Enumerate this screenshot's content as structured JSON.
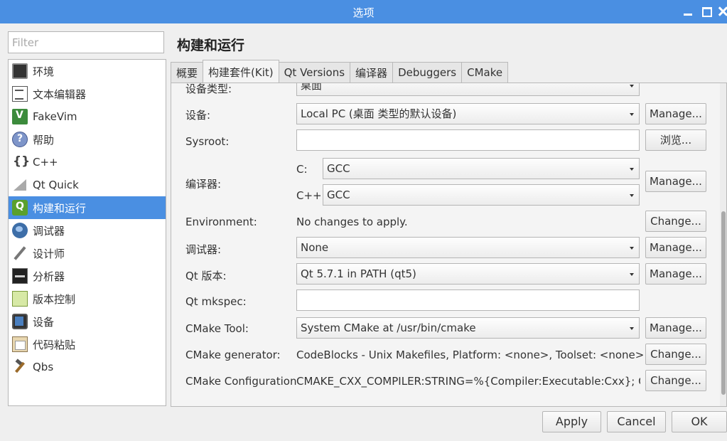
{
  "window": {
    "title": "选项"
  },
  "filter": {
    "placeholder": "Filter"
  },
  "sidebar": {
    "items": [
      {
        "label": "环境"
      },
      {
        "label": "文本编辑器"
      },
      {
        "label": "FakeVim"
      },
      {
        "label": "帮助"
      },
      {
        "label": "C++"
      },
      {
        "label": "Qt Quick"
      },
      {
        "label": "构建和运行",
        "selected": true
      },
      {
        "label": "调试器"
      },
      {
        "label": "设计师"
      },
      {
        "label": "分析器"
      },
      {
        "label": "版本控制"
      },
      {
        "label": "设备"
      },
      {
        "label": "代码粘贴"
      },
      {
        "label": "Qbs"
      }
    ]
  },
  "page": {
    "title": "构建和运行"
  },
  "tabs": [
    {
      "label": "概要"
    },
    {
      "label": "构建套件(Kit)",
      "active": true
    },
    {
      "label": "Qt Versions"
    },
    {
      "label": "编译器"
    },
    {
      "label": "Debuggers"
    },
    {
      "label": "CMake"
    }
  ],
  "kit": {
    "device_type": {
      "label": "设备类型:",
      "value": "桌面"
    },
    "device": {
      "label": "设备:",
      "value": "Local PC (桌面 类型的默认设备)",
      "button": "Manage..."
    },
    "sysroot": {
      "label": "Sysroot:",
      "value": "",
      "button": "浏览..."
    },
    "compiler": {
      "label": "编译器:",
      "c_label": "C:",
      "c_value": "GCC",
      "cxx_label": "C++:",
      "cxx_value": "GCC",
      "button": "Manage..."
    },
    "environment": {
      "label": "Environment:",
      "value": "No changes to apply.",
      "button": "Change..."
    },
    "debugger": {
      "label": "调试器:",
      "value": "None",
      "button": "Manage..."
    },
    "qt_version": {
      "label": "Qt 版本:",
      "value": "Qt 5.7.1 in PATH (qt5)",
      "button": "Manage..."
    },
    "qt_mkspec": {
      "label": "Qt mkspec:",
      "value": ""
    },
    "cmake_tool": {
      "label": "CMake Tool:",
      "value": "System CMake at /usr/bin/cmake",
      "button": "Manage..."
    },
    "cmake_generator": {
      "label": "CMake generator:",
      "value": "CodeBlocks - Unix Makefiles, Platform: <none>, Toolset: <none>",
      "button": "Change..."
    },
    "cmake_configuration": {
      "label": "CMake Configuration",
      "value": "CMAKE_CXX_COMPILER:STRING=%{Compiler:Executable:Cxx}; CM...",
      "button": "Change..."
    }
  },
  "footer": {
    "apply": "Apply",
    "cancel": "Cancel",
    "ok": "OK"
  }
}
